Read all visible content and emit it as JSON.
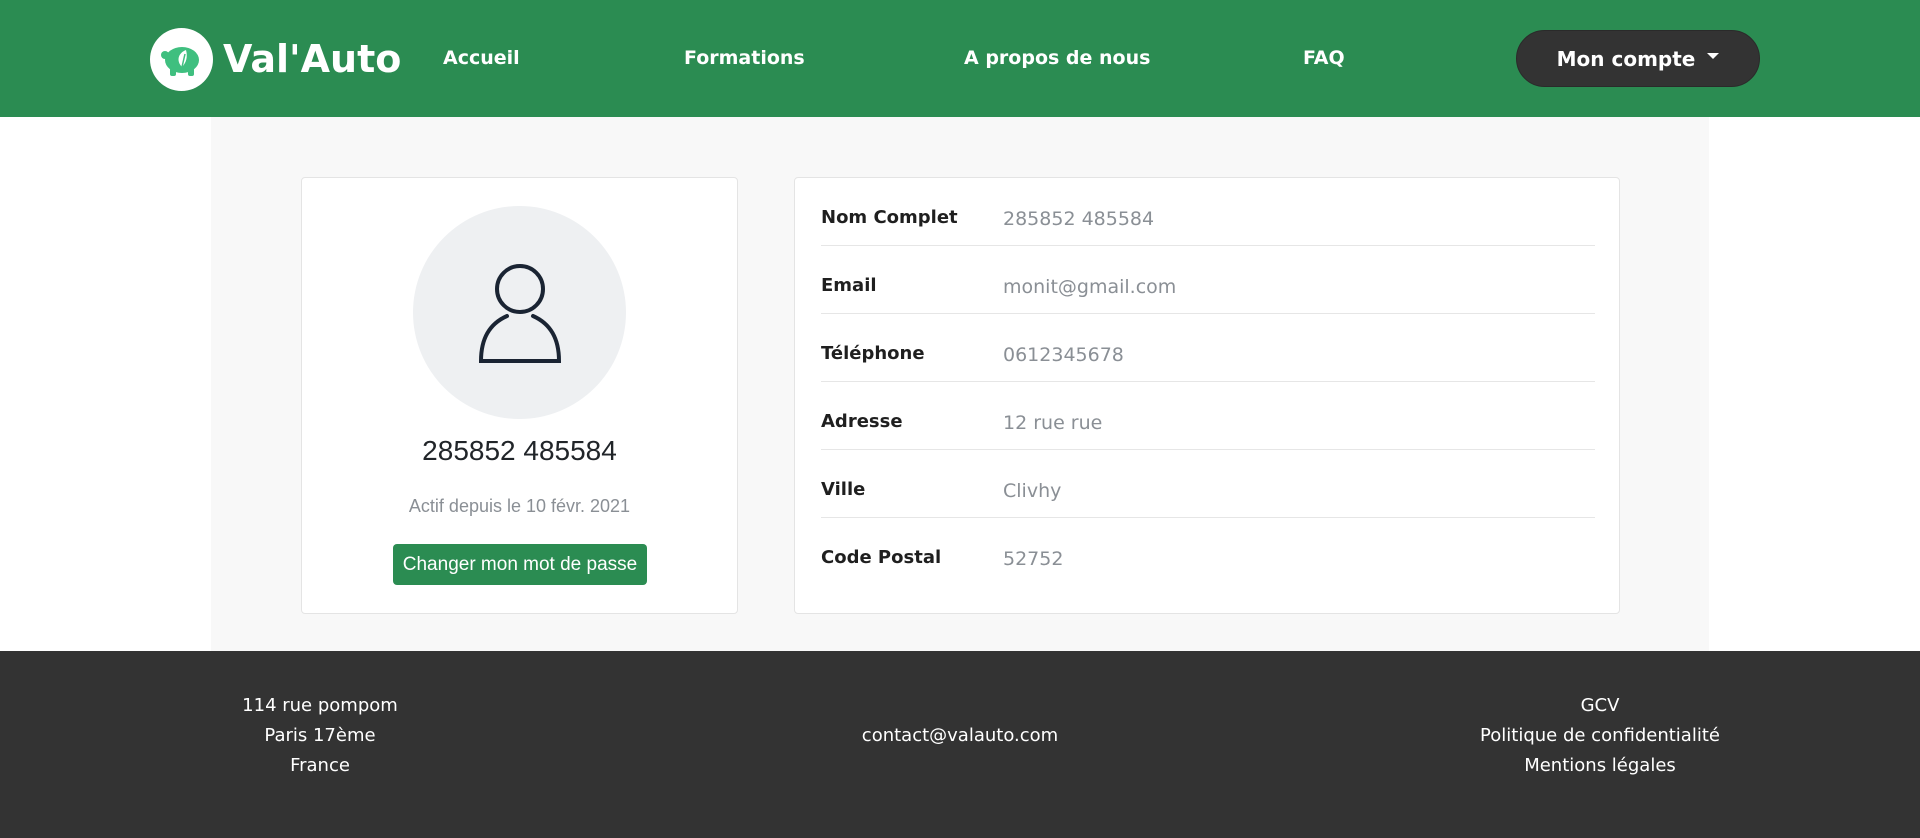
{
  "brand": {
    "name": "Val'Auto",
    "logo_icon": "piggy-bank-leaf-icon"
  },
  "nav": {
    "items": [
      {
        "label": "Accueil"
      },
      {
        "label": "Formations"
      },
      {
        "label": "A propos de nous"
      },
      {
        "label": "FAQ"
      }
    ],
    "account_label": "Mon compte"
  },
  "profile": {
    "avatar_icon": "user-icon",
    "name": "285852 485584",
    "since": "Actif depuis le 10 févr. 2021",
    "change_password_label": "Changer mon mot de passe"
  },
  "details": [
    {
      "label": "Nom Complet",
      "value": "285852 485584"
    },
    {
      "label": "Email",
      "value": "monit@gmail.com"
    },
    {
      "label": "Téléphone",
      "value": "0612345678"
    },
    {
      "label": "Adresse",
      "value": "12 rue rue"
    },
    {
      "label": "Ville",
      "value": "Clivhy"
    },
    {
      "label": "Code Postal",
      "value": "52752"
    }
  ],
  "footer": {
    "address": [
      "114 rue pompom",
      "Paris 17ème",
      "France"
    ],
    "contact_email": "contact@valauto.com",
    "links": [
      "GCV",
      "Politique de confidentialité",
      "Mentions légales"
    ]
  },
  "colors": {
    "primary_green": "#2b8c52",
    "dark": "#333333",
    "muted_text": "#8a8f95"
  }
}
